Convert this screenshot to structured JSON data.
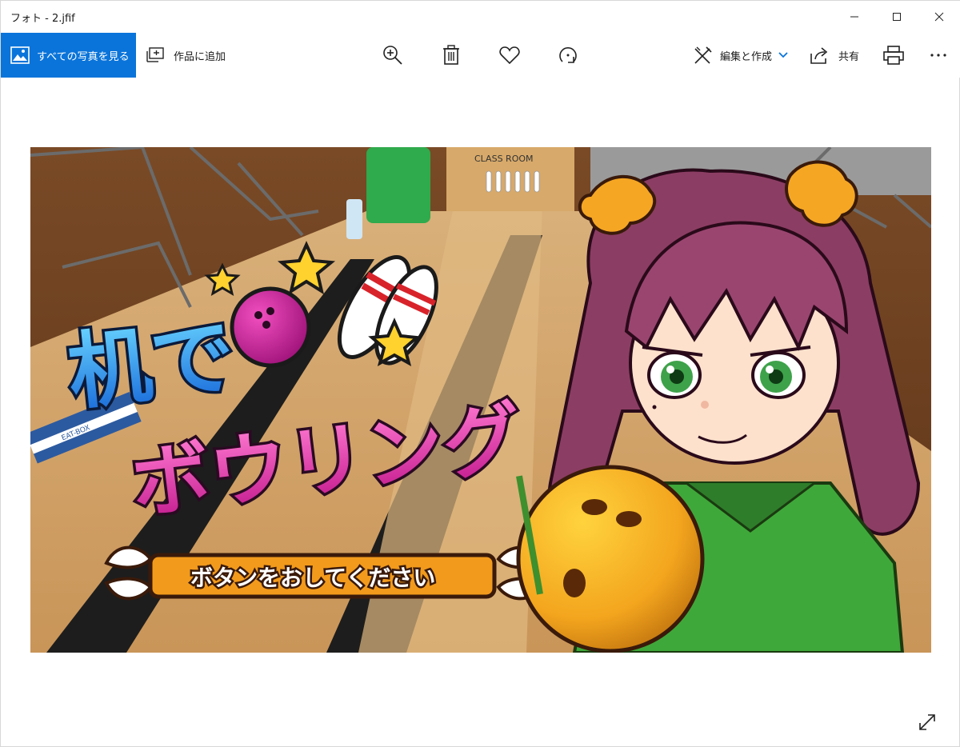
{
  "window": {
    "title": "フォト - 2.jfif"
  },
  "toolbar": {
    "all_photos_label": "すべての写真を見る",
    "add_to_creation_label": "作品に追加",
    "edit_create_label": "編集と作成",
    "share_label": "共有"
  },
  "photo": {
    "logo_line1": "机で",
    "logo_line2": "ボウリング",
    "prompt_label": "ボタンをおしてください",
    "sign_text": "CLASS ROOM",
    "eraser_text": "EAT-BOX"
  },
  "colors": {
    "accent": "#0a74da",
    "logo_blue": "#1e8fe8",
    "logo_pink": "#e2259a",
    "banner_orange": "#f29a1c",
    "ball_orange": "#f3a51e",
    "hair": "#8c3d63",
    "jacket_green": "#3fa83a"
  }
}
